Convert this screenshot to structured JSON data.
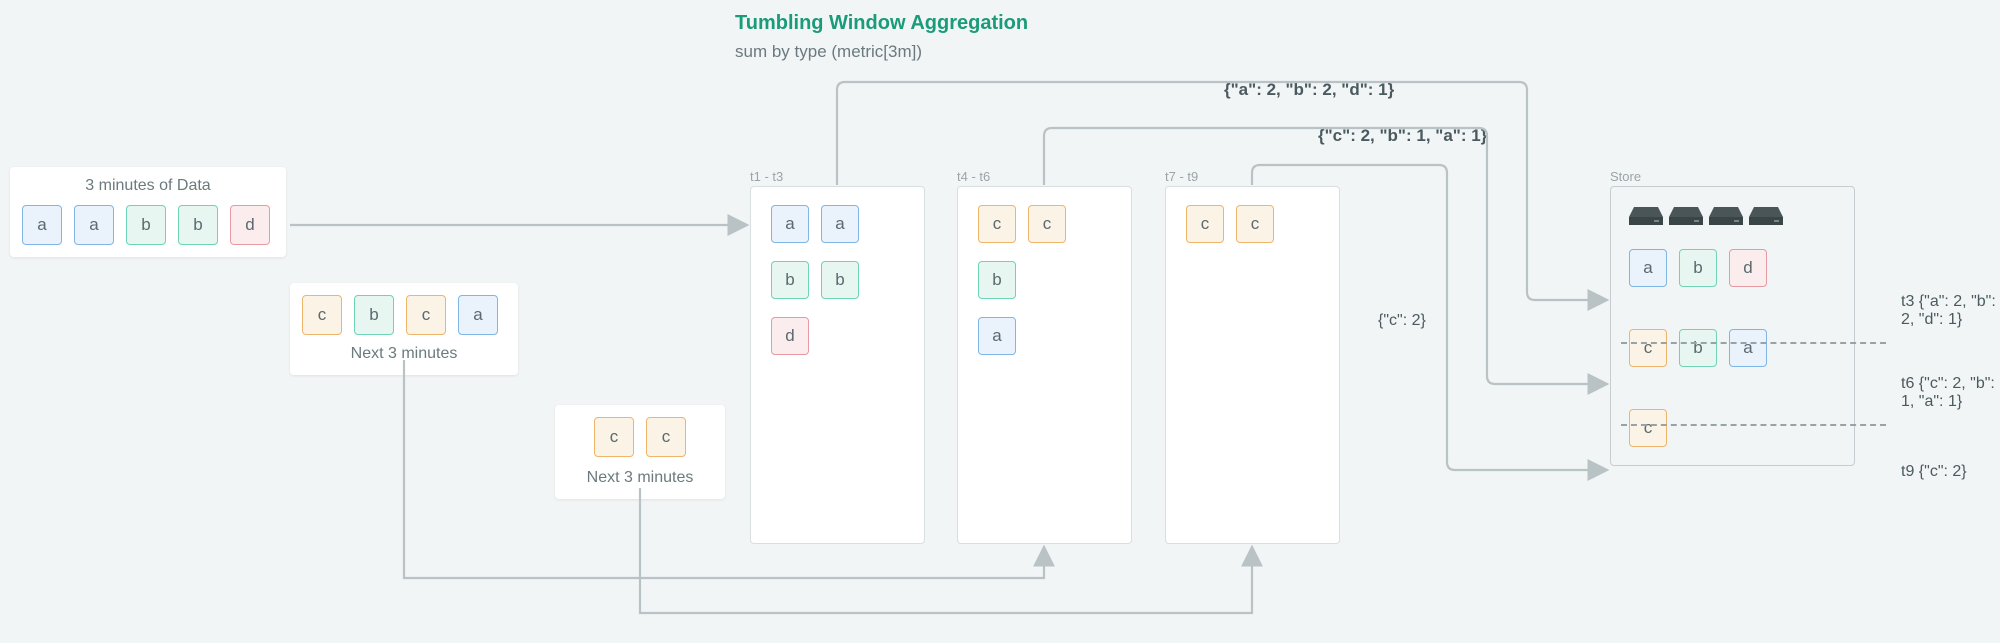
{
  "header": {
    "title": "Tumbling Window Aggregation",
    "subtitle": "sum by type (metric[3m])"
  },
  "sources": [
    {
      "label": "3 minutes of Data",
      "label_pos": "top",
      "tokens": [
        {
          "letter": "a",
          "color": "blue"
        },
        {
          "letter": "a",
          "color": "blue"
        },
        {
          "letter": "b",
          "color": "green"
        },
        {
          "letter": "b",
          "color": "green"
        },
        {
          "letter": "d",
          "color": "red"
        }
      ]
    },
    {
      "label": "Next 3 minutes",
      "label_pos": "bottom",
      "tokens": [
        {
          "letter": "c",
          "color": "orange"
        },
        {
          "letter": "b",
          "color": "green"
        },
        {
          "letter": "c",
          "color": "orange"
        },
        {
          "letter": "a",
          "color": "blue"
        }
      ]
    },
    {
      "label": "Next 3 minutes",
      "label_pos": "bottom",
      "tokens": [
        {
          "letter": "c",
          "color": "orange"
        },
        {
          "letter": "c",
          "color": "orange"
        }
      ]
    }
  ],
  "windows": [
    {
      "label": "t1 - t3",
      "rows": [
        [
          {
            "letter": "a",
            "color": "blue"
          },
          {
            "letter": "a",
            "color": "blue"
          }
        ],
        [
          {
            "letter": "b",
            "color": "green"
          },
          {
            "letter": "b",
            "color": "green"
          }
        ],
        [
          {
            "letter": "d",
            "color": "red"
          }
        ]
      ]
    },
    {
      "label": "t4 - t6",
      "rows": [
        [
          {
            "letter": "c",
            "color": "orange"
          },
          {
            "letter": "c",
            "color": "orange"
          }
        ],
        [
          {
            "letter": "b",
            "color": "green"
          }
        ],
        [
          {
            "letter": "a",
            "color": "blue"
          }
        ]
      ]
    },
    {
      "label": "t7 - t9",
      "rows": [
        [
          {
            "letter": "c",
            "color": "orange"
          },
          {
            "letter": "c",
            "color": "orange"
          }
        ]
      ]
    }
  ],
  "result_labels": {
    "top": "{\"a\": 2, \"b\": 2, \"d\": 1}",
    "mid": "{\"c\": 2, \"b\": 1, \"a\": 1}",
    "side": "{\"c\": 2}"
  },
  "store": {
    "label": "Store",
    "rows": [
      {
        "tokens": [
          {
            "letter": "a",
            "color": "blue"
          },
          {
            "letter": "b",
            "color": "green"
          },
          {
            "letter": "d",
            "color": "red"
          }
        ],
        "text": "t3 {\"a\": 2, \"b\": 2, \"d\": 1}"
      },
      {
        "tokens": [
          {
            "letter": "c",
            "color": "orange"
          },
          {
            "letter": "b",
            "color": "green"
          },
          {
            "letter": "a",
            "color": "blue"
          }
        ],
        "text": "t6 {\"c\": 2, \"b\": 1, \"a\": 1}"
      },
      {
        "tokens": [
          {
            "letter": "c",
            "color": "orange"
          }
        ],
        "text": "t9 {\"c\": 2}"
      }
    ]
  }
}
